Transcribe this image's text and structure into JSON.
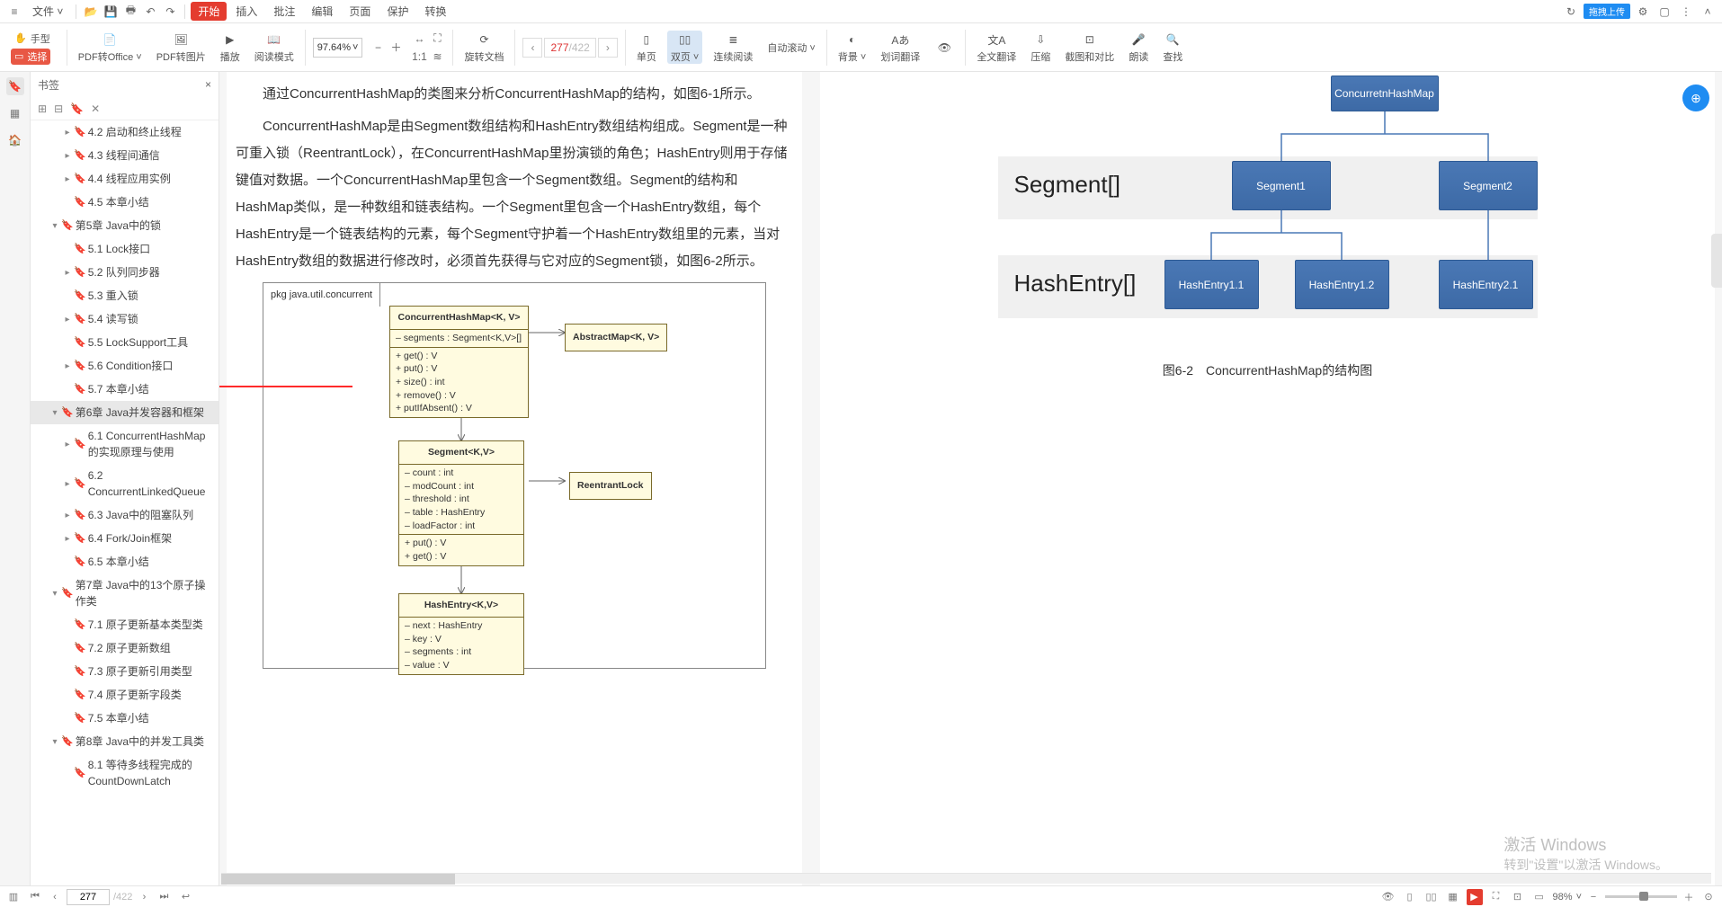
{
  "topbar": {
    "file": "文件",
    "menu": [
      "开始",
      "插入",
      "批注",
      "编辑",
      "页面",
      "保护",
      "转换"
    ],
    "right": {
      "tag": "拖拽上传"
    }
  },
  "ribbon": {
    "hand": "手型",
    "select": "选择",
    "groups": [
      {
        "lbl": "PDF转Office"
      },
      {
        "lbl": "PDF转图片"
      },
      {
        "lbl": "播放"
      },
      {
        "lbl": "阅读模式"
      }
    ],
    "zoom": "97.64%",
    "rotate": "旋转文档",
    "single": "单页",
    "double": "双页",
    "contread": "连续阅读",
    "autoscroll": "自动滚动",
    "bg": "背景",
    "dict": "划词翻译",
    "fulltran": "全文翻译",
    "compress": "压缩",
    "crop": "截图和对比",
    "read": "朗读",
    "find": "查找",
    "page_cur": "277",
    "page_total": "/422"
  },
  "bookmarks": {
    "title": "书签",
    "items": [
      {
        "t": "4.2 启动和终止线程",
        "p": 2,
        "a": "▸"
      },
      {
        "t": "4.3 线程间通信",
        "p": 2,
        "a": "▸"
      },
      {
        "t": "4.4 线程应用实例",
        "p": 2,
        "a": "▸"
      },
      {
        "t": "4.5 本章小结",
        "p": 2,
        "a": ""
      },
      {
        "t": "第5章 Java中的锁",
        "p": 1,
        "a": "▾"
      },
      {
        "t": "5.1 Lock接口",
        "p": 2,
        "a": ""
      },
      {
        "t": "5.2 队列同步器",
        "p": 2,
        "a": "▸"
      },
      {
        "t": "5.3 重入锁",
        "p": 2,
        "a": ""
      },
      {
        "t": "5.4 读写锁",
        "p": 2,
        "a": "▸"
      },
      {
        "t": "5.5 LockSupport工具",
        "p": 2,
        "a": ""
      },
      {
        "t": "5.6 Condition接口",
        "p": 2,
        "a": "▸"
      },
      {
        "t": "5.7 本章小结",
        "p": 2,
        "a": ""
      },
      {
        "t": "第6章 Java并发容器和框架",
        "p": 1,
        "a": "▾",
        "sel": true
      },
      {
        "t": "6.1 ConcurrentHashMap的实现原理与使用",
        "p": 2,
        "a": "▸"
      },
      {
        "t": "6.2 ConcurrentLinkedQueue",
        "p": 2,
        "a": "▸"
      },
      {
        "t": "6.3 Java中的阻塞队列",
        "p": 2,
        "a": "▸"
      },
      {
        "t": "6.4 Fork/Join框架",
        "p": 2,
        "a": "▸"
      },
      {
        "t": "6.5 本章小结",
        "p": 2,
        "a": ""
      },
      {
        "t": "第7章 Java中的13个原子操作类",
        "p": 1,
        "a": "▾"
      },
      {
        "t": "7.1 原子更新基本类型类",
        "p": 2,
        "a": ""
      },
      {
        "t": "7.2 原子更新数组",
        "p": 2,
        "a": ""
      },
      {
        "t": "7.3 原子更新引用类型",
        "p": 2,
        "a": ""
      },
      {
        "t": "7.4 原子更新字段类",
        "p": 2,
        "a": ""
      },
      {
        "t": "7.5 本章小结",
        "p": 2,
        "a": ""
      },
      {
        "t": "第8章 Java中的并发工具类",
        "p": 1,
        "a": "▾"
      },
      {
        "t": "8.1 等待多线程完成的CountDownLatch",
        "p": 2,
        "a": ""
      }
    ]
  },
  "content": {
    "p1": "通过ConcurrentHashMap的类图来分析ConcurrentHashMap的结构，如图6-1所示。",
    "p2": "ConcurrentHashMap是由Segment数组结构和HashEntry数组结构组成。Segment是一种可重入锁（ReentrantLock），在ConcurrentHashMap里扮演锁的角色；HashEntry则用于存储键值对数据。一个ConcurrentHashMap里包含一个Segment数组。Segment的结构和HashMap类似，是一种数组和链表结构。一个Segment里包含一个HashEntry数组，每个HashEntry是一个链表结构的元素，每个Segment守护着一个HashEntry数组里的元素，当对HashEntry数组的数据进行修改时，必须首先获得与它对应的Segment锁，如图6-2所示。",
    "pkg": "pkg java.util.concurrent",
    "uml": {
      "chm": {
        "h": "ConcurrentHashMap<K, V>",
        "f": "– segments : Segment<K,V>[]",
        "m": "+ get() : V\n+ put() : V\n+ size() : int\n+ remove() : V\n+ putIfAbsent() : V"
      },
      "abs": "AbstractMap<K, V>",
      "seg": {
        "h": "Segment<K,V>",
        "f": "– count : int\n– modCount : int\n– threshold : int\n– table : HashEntry<K,V>\n– loadFactor : int",
        "m": "+ put() : V\n+ get() : V"
      },
      "rlock": "ReentrantLock",
      "he": {
        "h": "HashEntry<K,V>",
        "f": "– next : HashEntry<K,V>\n– key : V\n– segments : int\n– value : V"
      }
    },
    "diagram": {
      "root": "ConcurretnHashMap",
      "band1": "Segment[]",
      "seg1": "Segment1",
      "seg2": "Segment2",
      "band2": "HashEntry[]",
      "he11": "HashEntry1.1",
      "he12": "HashEntry1.2",
      "he21": "HashEntry2.1"
    },
    "caption": "图6-2　ConcurrentHashMap的结构图"
  },
  "status": {
    "page_cur": "277",
    "page_total": "/422",
    "zoom": "98%"
  },
  "watermark": {
    "t1": "激活 Windows",
    "t2": "转到\"设置\"以激活 Windows。"
  }
}
